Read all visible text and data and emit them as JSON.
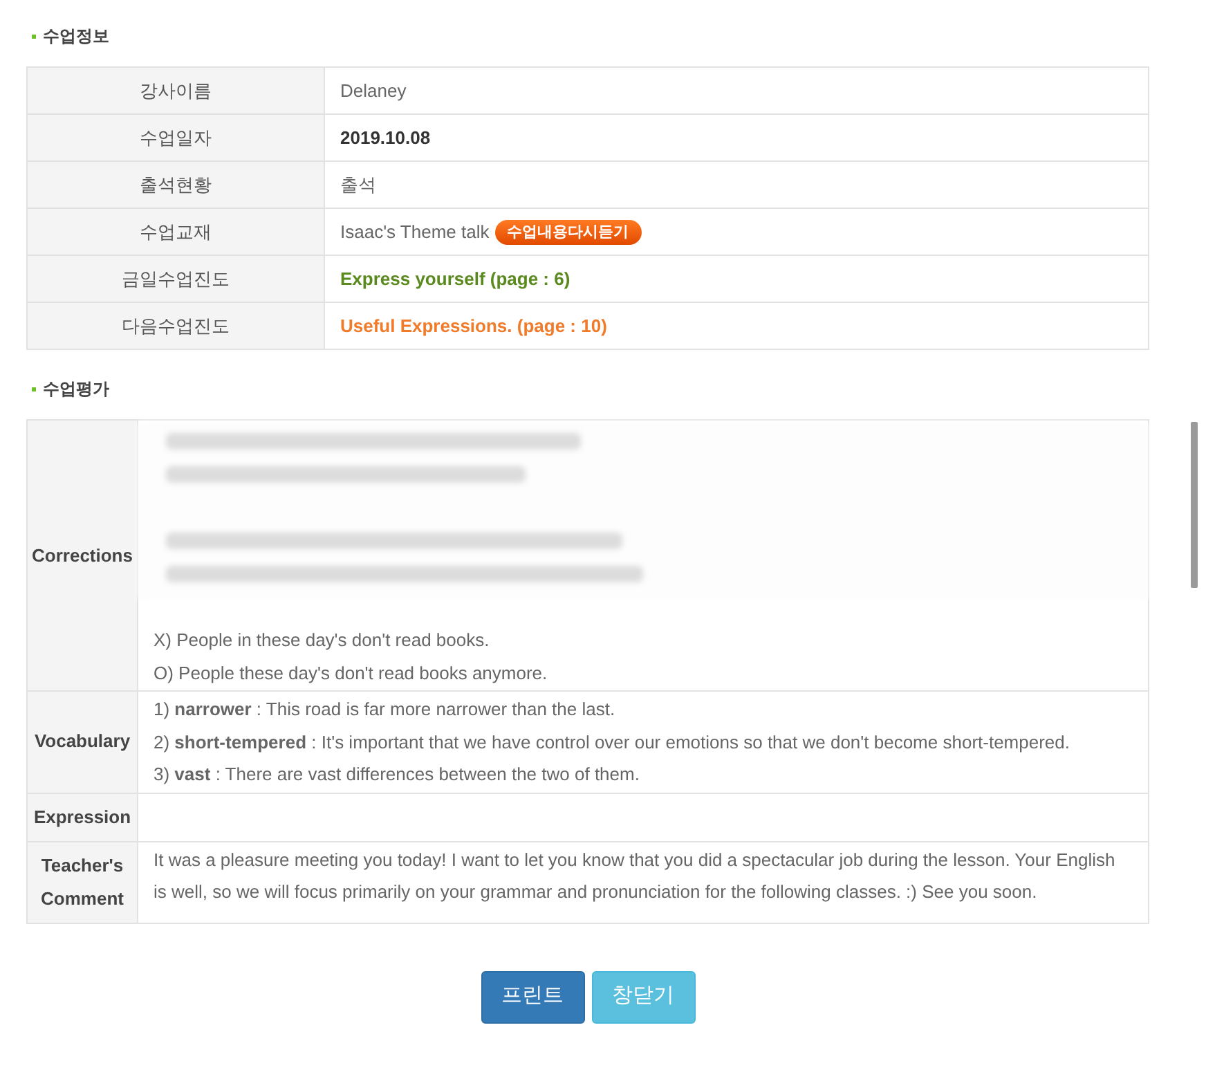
{
  "info_section": {
    "title": "수업정보",
    "rows": [
      {
        "label": "강사이름",
        "value": "Delaney",
        "kind": "plain"
      },
      {
        "label": "수업일자",
        "value": "2019.10.08",
        "kind": "bold"
      },
      {
        "label": "출석현황",
        "value": "출석",
        "kind": "plain"
      },
      {
        "label": "수업교재",
        "value": "Isaac's Theme talk",
        "kind": "plain",
        "badge": "수업내용다시듣기"
      },
      {
        "label": "금일수업진도",
        "value": "Express yourself (page : 6)",
        "kind": "green"
      },
      {
        "label": "다음수업진도",
        "value": "Useful Expressions. (page : 10)",
        "kind": "orange"
      }
    ]
  },
  "evaluation_section": {
    "title": "수업평가",
    "rows": [
      {
        "label": "Corrections",
        "blurred": true,
        "lines": [
          "X) People in these day's don't read books.",
          "O) People these day's don't read books anymore."
        ]
      },
      {
        "label": "Vocabulary",
        "blurred": false,
        "lines": [
          "1) **narrower** : This road is far more narrower than the last.",
          "2) **short-tempered** : It's important that we have control over our emotions so that we don't become short-tempered.",
          "3) **vast** : There are vast differences between the two of them."
        ]
      },
      {
        "label": "Expression",
        "blurred": false,
        "lines": []
      },
      {
        "label": "Teacher's Comment",
        "blurred": false,
        "lines": [
          "It was a pleasure meeting you today! I want to let you know that you did a spectacular job during the lesson. Your English is well, so we will focus primarily on your grammar and pronunciation for the following classes. :) See you soon."
        ]
      }
    ]
  },
  "buttons": [
    {
      "label": "프린트",
      "kind": "primary"
    },
    {
      "label": "창닫기",
      "kind": "info"
    }
  ]
}
